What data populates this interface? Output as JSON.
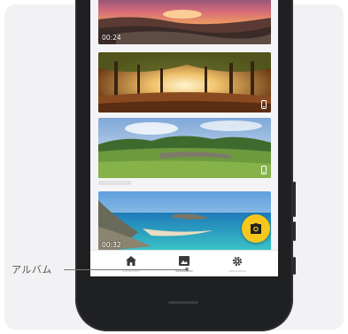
{
  "colors": {
    "fab": "#f7c71c",
    "navbar_bg": "#ffffff",
    "phone_body": "#1f2022",
    "page_bg": "#f2f2f4"
  },
  "gallery": {
    "items": [
      {
        "scene": "sunset-coast",
        "duration": "00:24",
        "badge": "none"
      },
      {
        "scene": "forest-panorama",
        "duration": "",
        "badge": "phone-icon"
      },
      {
        "scene": "green-hillside",
        "duration": "",
        "badge": "phone-icon"
      },
      {
        "scene": "turquoise-bay",
        "duration": "00:32",
        "badge": "none"
      }
    ]
  },
  "fab": {
    "icon": "camera-icon"
  },
  "navbar": {
    "items": [
      {
        "icon": "home-icon",
        "active": false
      },
      {
        "icon": "album-icon",
        "active": true
      },
      {
        "icon": "gear-icon",
        "active": false
      }
    ]
  },
  "callout": {
    "label": "アルバム"
  }
}
